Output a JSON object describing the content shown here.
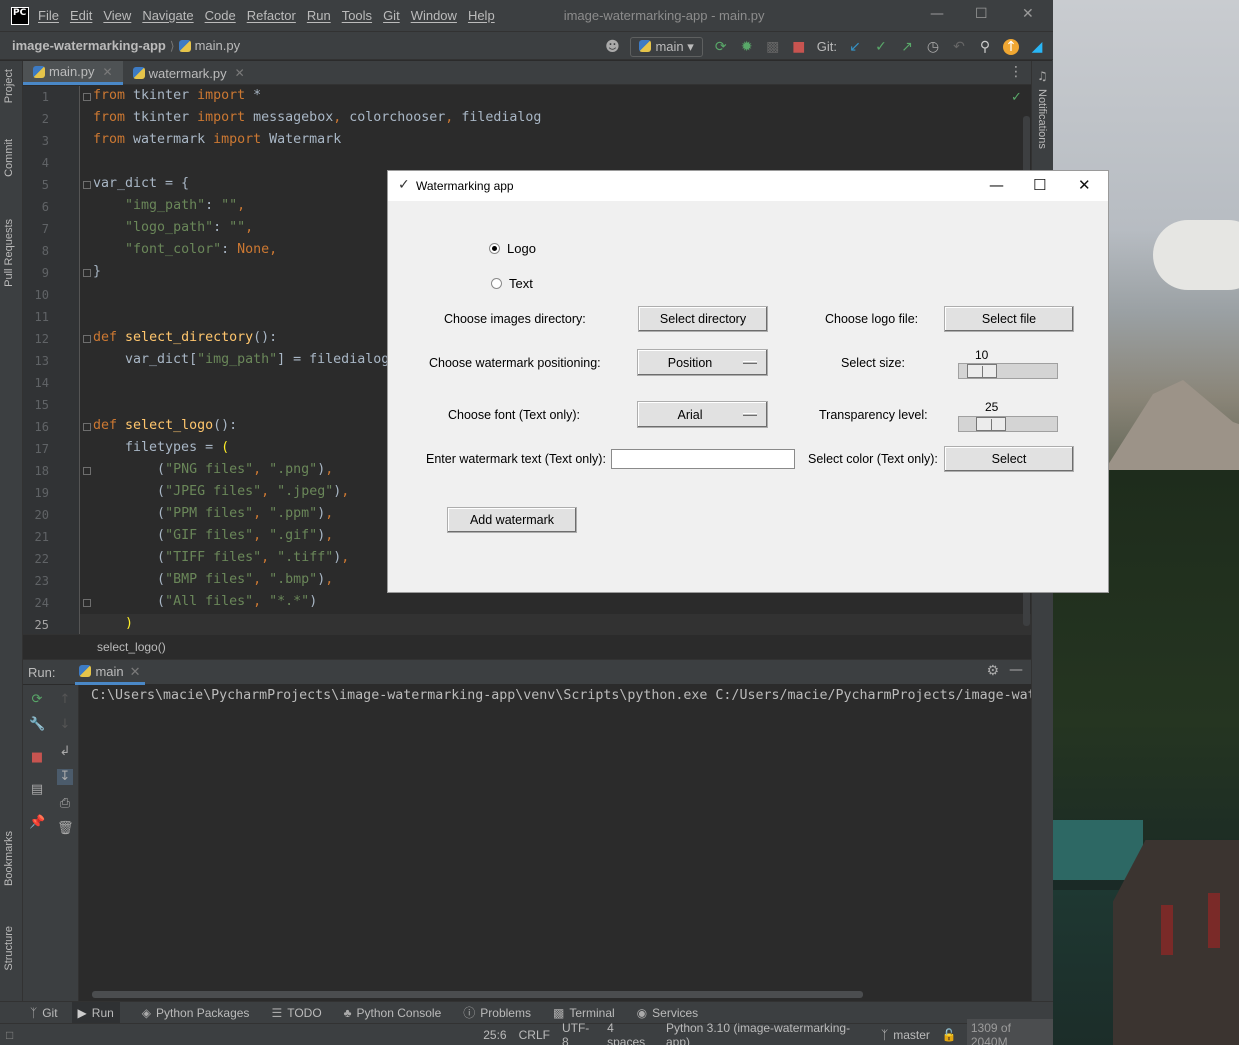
{
  "window": {
    "title": "image-watermarking-app - main.py",
    "logo": "PC"
  },
  "menu": [
    "File",
    "Edit",
    "View",
    "Navigate",
    "Code",
    "Refactor",
    "Run",
    "Tools",
    "Git",
    "Window",
    "Help"
  ],
  "navbar": {
    "project": "image-watermarking-app",
    "file": "main.py",
    "branch": "main",
    "git_label": "Git:"
  },
  "left_tabs": [
    "Project",
    "Commit",
    "Pull Requests",
    "Bookmarks",
    "Structure"
  ],
  "right_tabs": [
    "Notifications"
  ],
  "editor_tabs": [
    {
      "label": "main.py",
      "active": true
    },
    {
      "label": "watermark.py",
      "active": false
    }
  ],
  "editor": {
    "line_numbers": [
      "1",
      "2",
      "3",
      "4",
      "5",
      "6",
      "7",
      "8",
      "9",
      "10",
      "11",
      "12",
      "13",
      "14",
      "15",
      "16",
      "17",
      "18",
      "19",
      "20",
      "21",
      "22",
      "23",
      "24",
      "25"
    ],
    "current_line": "25",
    "breadcrumb": "select_logo()"
  },
  "run_panel": {
    "label": "Run:",
    "tab": "main",
    "output": "C:\\Users\\macie\\PycharmProjects\\image-watermarking-app\\venv\\Scripts\\python.exe C:/Users/macie/PycharmProjects/image-wat"
  },
  "bottom_tabs": [
    {
      "label": "Git",
      "icon": "branch-icon"
    },
    {
      "label": "Run",
      "icon": "run-icon"
    },
    {
      "label": "Python Packages",
      "icon": "packages-icon"
    },
    {
      "label": "TODO",
      "icon": "todo-icon"
    },
    {
      "label": "Python Console",
      "icon": "python-console-icon"
    },
    {
      "label": "Problems",
      "icon": "problems-icon"
    },
    {
      "label": "Terminal",
      "icon": "terminal-icon"
    },
    {
      "label": "Services",
      "icon": "services-icon"
    }
  ],
  "status": {
    "position": "25:6",
    "line_sep": "CRLF",
    "encoding": "UTF-8",
    "indent": "4 spaces",
    "interpreter": "Python 3.10 (image-watermarking-app)",
    "vcs_branch": "master",
    "memory": "1309 of 2040M"
  },
  "tk_app": {
    "title": "Watermarking app",
    "radio_logo": "Logo",
    "radio_text": "Text",
    "radio_selected": "Logo",
    "label_images_dir": "Choose images directory:",
    "btn_select_directory": "Select directory",
    "label_logo_file": "Choose logo file:",
    "btn_select_file": "Select file",
    "label_positioning": "Choose watermark positioning:",
    "menu_position": "Position",
    "label_size": "Select size:",
    "size_value": "10",
    "label_font": "Choose font (Text only):",
    "menu_font": "Arial",
    "label_transparency": "Transparency level:",
    "transparency_value": "25",
    "label_watermark_text": "Enter watermark text (Text only):",
    "watermark_text_value": "",
    "label_color": "Select color (Text only):",
    "btn_select_color": "Select",
    "btn_add_watermark": "Add watermark"
  },
  "colors": {
    "ide_bg": "#2b2b2b",
    "ide_panel": "#3c3f41",
    "keyword": "#cc7832",
    "string": "#6a8759",
    "function": "#ffc66d",
    "accent": "#4a88c7",
    "tk_bg": "#f0f0f0"
  }
}
